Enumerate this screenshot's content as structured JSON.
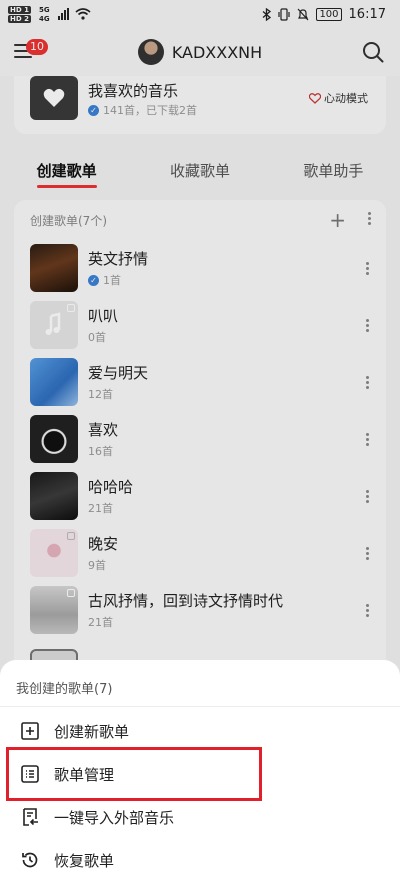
{
  "status_bar": {
    "hd1": "HD 1",
    "hd2": "HD 2",
    "net1": "5G",
    "net2": "4G",
    "battery": "100",
    "time": "16:17"
  },
  "header": {
    "badge_count": "10",
    "username": "KADXXXNH"
  },
  "liked": {
    "title": "我喜欢的音乐",
    "subtitle": "141首，已下载2首",
    "heart_mode": "心动模式"
  },
  "tabs": [
    {
      "label": "创建歌单",
      "active": true
    },
    {
      "label": "收藏歌单",
      "active": false
    },
    {
      "label": "歌单助手",
      "active": false
    }
  ],
  "playlists": {
    "header": "创建歌单(7个)",
    "items": [
      {
        "name": "英文抒情",
        "count": "1首",
        "verified": true
      },
      {
        "name": "叭叭",
        "count": "0首",
        "verified": false
      },
      {
        "name": "爱与明天",
        "count": "12首",
        "verified": false
      },
      {
        "name": "喜欢",
        "count": "16首",
        "verified": false
      },
      {
        "name": "哈哈哈",
        "count": "21首",
        "verified": false
      },
      {
        "name": "晚安",
        "count": "9首",
        "verified": false
      },
      {
        "name": "古风抒情，回到诗文抒情时代",
        "count": "21首",
        "verified": false
      }
    ]
  },
  "sheet": {
    "title": "我创建的歌单(7)",
    "items": [
      {
        "label": "创建新歌单",
        "icon": "plus-square-icon"
      },
      {
        "label": "歌单管理",
        "icon": "list-manage-icon"
      },
      {
        "label": "一键导入外部音乐",
        "icon": "import-icon"
      },
      {
        "label": "恢复歌单",
        "icon": "restore-icon"
      }
    ]
  },
  "colors": {
    "accent_red": "#e33333",
    "highlight": "#e0202a",
    "verified_blue": "#3b83d6"
  }
}
